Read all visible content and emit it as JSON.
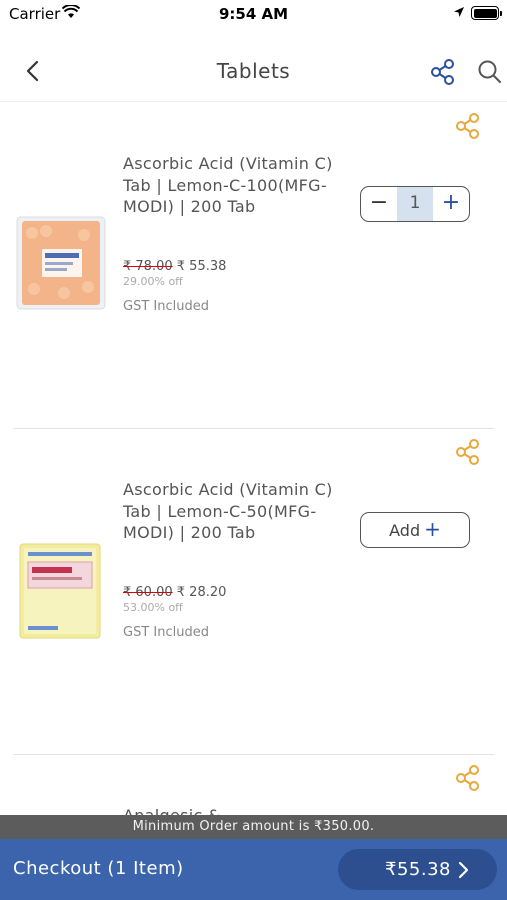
{
  "status_bar": {
    "carrier": "Carrier",
    "time": "9:54 AM"
  },
  "nav": {
    "title": "Tablets"
  },
  "products": [
    {
      "name": "Ascorbic Acid (Vitamin C) Tab | Lemon-C-100(MFG-MODI) | 200 Tab",
      "mrp": "₹ 78.00",
      "price": "₹ 55.38",
      "discount": "29.00% off",
      "gst": "GST Included",
      "quantity": "1",
      "thumb_color": "#f4b48a"
    },
    {
      "name": "Ascorbic Acid (Vitamin C) Tab | Lemon-C-50(MFG-MODI) | 200 Tab",
      "mrp": "₹ 60.00",
      "price": "₹ 28.20",
      "discount": "53.00% off",
      "gst": "GST Included",
      "add_label": "Add",
      "thumb_color": "#f3ec9c"
    },
    {
      "name": "Analgesic &"
    }
  ],
  "min_order": "Minimum Order amount is ₹350.00.",
  "checkout": {
    "label": "Checkout (1 Item)",
    "total": "₹55.38"
  },
  "colors": {
    "accent": "#3b64ad",
    "share_orange": "#e8a83a",
    "share_blue": "#2a4f9e"
  }
}
